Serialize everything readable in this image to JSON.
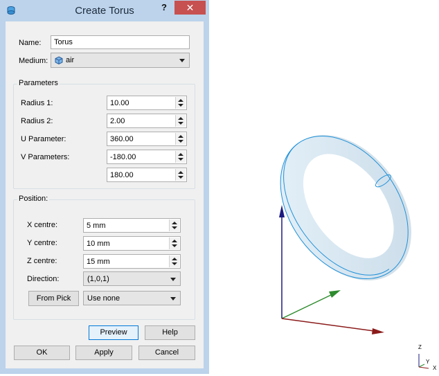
{
  "dialog": {
    "title": "Create Torus",
    "help_label": "?",
    "close_label": "✕",
    "name_label": "Name:",
    "name_value": "Torus",
    "medium_label": "Medium:",
    "medium_value": "air",
    "parameters": {
      "title": "Parameters",
      "radius1_label": "Radius 1:",
      "radius1_value": "10.00",
      "radius2_label": "Radius 2:",
      "radius2_value": "2.00",
      "u_label": "U Parameter:",
      "u_value": "360.00",
      "v_label": "V Parameters:",
      "v_value_1": "-180.00",
      "v_value_2": "180.00"
    },
    "position": {
      "title": "Position:",
      "x_label": "X centre:",
      "x_value": "5 mm",
      "y_label": "Y centre:",
      "y_value": "10 mm",
      "z_label": "Z centre:",
      "z_value": "15 mm",
      "direction_label": "Direction:",
      "direction_value": "(1,0,1)",
      "from_pick_label": "From Pick",
      "use_value": "Use none"
    },
    "buttons": {
      "preview": "Preview",
      "help": "Help",
      "ok": "OK",
      "apply": "Apply",
      "cancel": "Cancel"
    }
  },
  "viewport": {
    "triad": {
      "z": "Z",
      "y": "Y",
      "x": "X"
    }
  },
  "colors": {
    "frame": "#bcd3eb",
    "close": "#c75050",
    "torus_fill": "#dcecf6",
    "torus_edge": "#1e90d8",
    "axis_x": "#8b1a1a",
    "axis_y": "#2e8b2e",
    "axis_z": "#1a1a80"
  }
}
